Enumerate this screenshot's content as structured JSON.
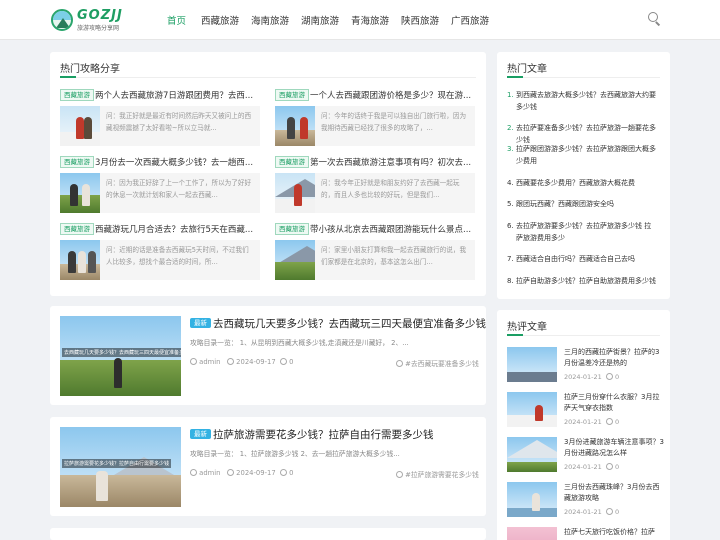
{
  "site": {
    "logo_text": "GOZJJ",
    "logo_sub": "旅游攻略分享网",
    "brand_color": "#1a9e63"
  },
  "nav": [
    {
      "label": "首页",
      "active": true
    },
    {
      "label": "西藏旅游"
    },
    {
      "label": "海南旅游"
    },
    {
      "label": "湖南旅游"
    },
    {
      "label": "青海旅游"
    },
    {
      "label": "陕西旅游"
    },
    {
      "label": "广西旅游"
    }
  ],
  "hot": {
    "title": "热门攻略分享",
    "items": [
      {
        "tag": "西藏旅游",
        "title": "两个人去西藏旅游7日游跟团费用？去西...",
        "desc": "问：我正好就是最近有时间然后昨天又被问上的西藏视频震撼了太好看啦~所以立马就..."
      },
      {
        "tag": "西藏旅游",
        "title": "一个人去西藏跟团游价格是多少？现在游...",
        "desc": "问：今年的话终于我是可以独自出门旅行啦，因为我期待西藏已经找了很多的攻略了，..."
      },
      {
        "tag": "西藏旅游",
        "title": "3月份去一次西藏大概多少钱？去一趟西...",
        "desc": "问：因为我正好辞了上一个工作了，所以为了好好的休息一次就计划和家人一起去西藏..."
      },
      {
        "tag": "西藏旅游",
        "title": "第一次去西藏旅游注意事项有吗？初次去...",
        "desc": "问：我今年正好就是和朋友约好了去西藏一起玩的，而且人多也比较的好玩，但是我们..."
      },
      {
        "tag": "西藏旅游",
        "title": "西藏游玩几月合适去？去旅行5天在西藏...",
        "desc": "问：近期的话是准备去西藏玩5天时间，不过我们人比较多，想找个最合适的时间，所..."
      },
      {
        "tag": "西藏旅游",
        "title": "带小孩从北京去西藏跟团游能玩什么景点...",
        "desc": "问：家里小朋友打算和我一起去西藏旅行的说，我们家都是在北京的，基本这怎么出门..."
      }
    ]
  },
  "articles": [
    {
      "badge": "最新",
      "title": "去西藏玩几天要多少钱？去西藏玩三四天最便宜准备多少钱",
      "excerpt": "攻略目录一览： 1、从昆明到西藏大概多少钱,走滇藏还是川藏好， 2、...",
      "thumb_caption": "去西藏玩几天要多少钱？去西藏玩三四天最便宜准备多少钱",
      "author": "admin",
      "date": "2024-09-17",
      "comments": "0",
      "tag": "#去西藏玩要准备多少钱"
    },
    {
      "badge": "最新",
      "title": "拉萨旅游需要花多少钱？拉萨自由行需要多少钱",
      "excerpt": "攻略目录一览： 1、拉萨旅游多少钱 2、去一趟拉萨旅游大概多少钱...",
      "thumb_caption": "拉萨旅游需要花多少钱？拉萨自由行需要多少钱",
      "author": "admin",
      "date": "2024-09-17",
      "comments": "0",
      "tag": "#拉萨旅游需要花多少钱"
    }
  ],
  "hot_posts": {
    "title": "热门文章",
    "items": [
      {
        "num": "1.",
        "text": "到西藏去旅游大概多少钱？去西藏旅游大约要多少钱"
      },
      {
        "num": "2.",
        "text": "去拉萨要准备多少钱？去拉萨旅游一趟要花多少钱"
      },
      {
        "num": "3.",
        "text": "拉萨跟团游游多少钱？去拉萨旅游跟团大概多少费用"
      },
      {
        "num": "4.",
        "text": "西藏要花多少费用？西藏旅游大概花费"
      },
      {
        "num": "5.",
        "text": "跟团玩西藏？西藏跟团游安全吗"
      },
      {
        "num": "6.",
        "text": "去拉萨旅游要多少钱？去拉萨旅游多少钱 拉萨旅游费用多少"
      },
      {
        "num": "7.",
        "text": "西藏适合自由行吗？西藏适合自己去吗"
      },
      {
        "num": "8.",
        "text": "拉萨自助游多少钱？拉萨自助旅游费用多少钱"
      }
    ]
  },
  "reviews": {
    "title": "热评文章",
    "items": [
      {
        "title": "三月的西藏拉萨街景？拉萨的3月份温差冷还是热的",
        "date": "2024-01-21",
        "comments": "0"
      },
      {
        "title": "拉萨三月份穿什么衣服？3月拉萨天气穿衣指数",
        "date": "2024-01-21",
        "comments": "0"
      },
      {
        "title": "3月份进藏旅游车辆注意事项？3月份进藏路况怎么样",
        "date": "2024-01-21",
        "comments": "0"
      },
      {
        "title": "三月份去西藏珠峰？3月份去西藏旅游攻略",
        "date": "2024-01-21",
        "comments": "0"
      },
      {
        "title": "拉萨七天旅行吃饭价格？拉萨",
        "date": "",
        "comments": ""
      }
    ]
  }
}
